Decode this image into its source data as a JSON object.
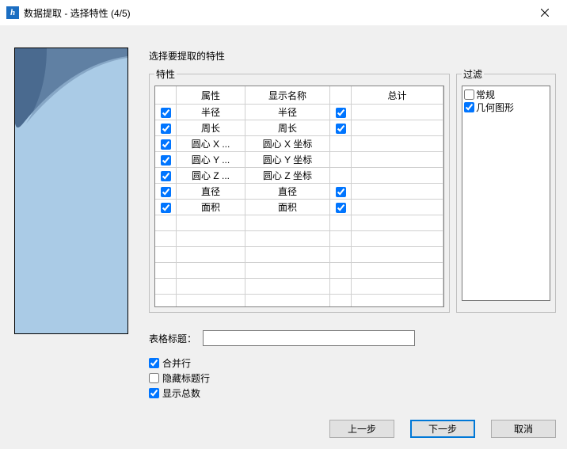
{
  "window": {
    "title": "数据提取 - 选择特性 (4/5)",
    "icon_letter": "h"
  },
  "heading": "选择要提取的特性",
  "props_legend": "特性",
  "filter_legend": "过滤",
  "table": {
    "headers": {
      "attr": "属性",
      "disp": "显示名称",
      "total": "总计"
    },
    "rows": [
      {
        "sel": true,
        "attr": "半径",
        "disp": "半径",
        "total_applicable": true,
        "total": true
      },
      {
        "sel": true,
        "attr": "周长",
        "disp": "周长",
        "total_applicable": true,
        "total": true
      },
      {
        "sel": true,
        "attr": "圆心 X ...",
        "disp": "圆心 X 坐标",
        "total_applicable": false,
        "total": false
      },
      {
        "sel": true,
        "attr": "圆心 Y ...",
        "disp": "圆心 Y 坐标",
        "total_applicable": false,
        "total": false
      },
      {
        "sel": true,
        "attr": "圆心 Z ...",
        "disp": "圆心 Z 坐标",
        "total_applicable": false,
        "total": false
      },
      {
        "sel": true,
        "attr": "直径",
        "disp": "直径",
        "total_applicable": true,
        "total": true
      },
      {
        "sel": true,
        "attr": "面积",
        "disp": "面积",
        "total_applicable": true,
        "total": true
      }
    ]
  },
  "filters": [
    {
      "label": "常规",
      "checked": false
    },
    {
      "label": "几何图形",
      "checked": true
    }
  ],
  "title_label": "表格标题：",
  "title_value": "",
  "options": {
    "merge": {
      "label": "合并行",
      "checked": true
    },
    "hidehdr": {
      "label": "隐藏标题行",
      "checked": false
    },
    "showtot": {
      "label": "显示总数",
      "checked": true
    }
  },
  "buttons": {
    "back": "上一步",
    "next": "下一步",
    "cancel": "取消"
  }
}
